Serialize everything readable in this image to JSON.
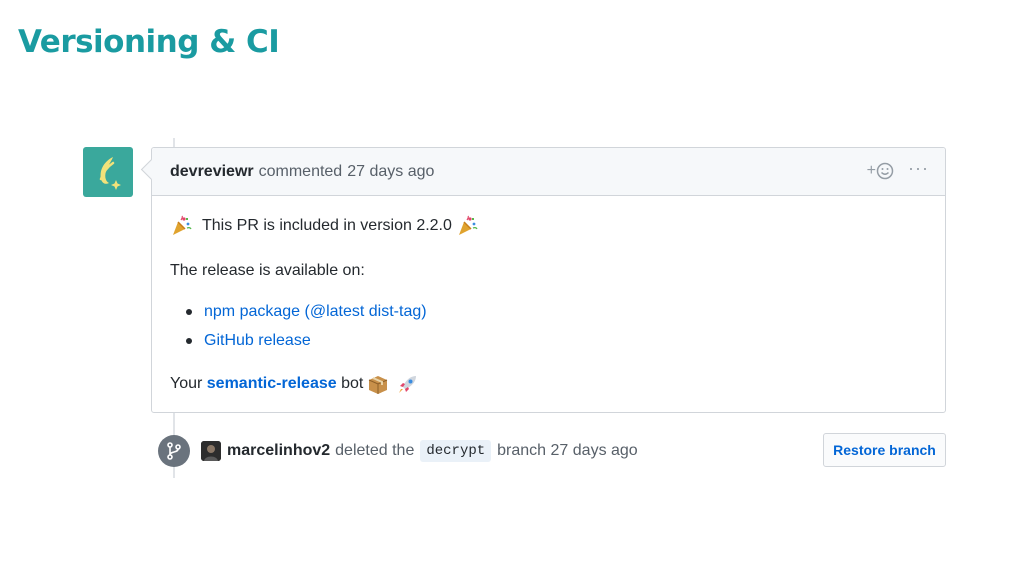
{
  "slide": {
    "title": "Versioning & CI"
  },
  "comment": {
    "author": "devreviewr",
    "action": "commented",
    "time": "27 days ago",
    "header_actions": {
      "reaction_label": "+",
      "reaction_icon": "smiley-icon",
      "more_label": "···"
    },
    "body": {
      "line1_text": "This PR is included in version 2.2.0",
      "line1_emoji": "party-popper-icon",
      "line2_text": "The release is available on:",
      "links": [
        {
          "label": "npm package (@latest dist-tag)"
        },
        {
          "label": "GitHub release"
        }
      ],
      "sign_prefix": "Your",
      "sign_link": "semantic-release",
      "sign_suffix": "bot",
      "sign_icons": [
        "package-icon",
        "rocket-icon"
      ]
    }
  },
  "event": {
    "actor": "marcelinhov2",
    "action": "deleted the",
    "branch": "decrypt",
    "suffix": "branch 27 days ago",
    "restore_label": "Restore branch",
    "icon": "git-branch-icon"
  },
  "colors": {
    "title": "#1a9ba1",
    "link": "#0366d6",
    "avatar_bg": "#3aa89c"
  }
}
